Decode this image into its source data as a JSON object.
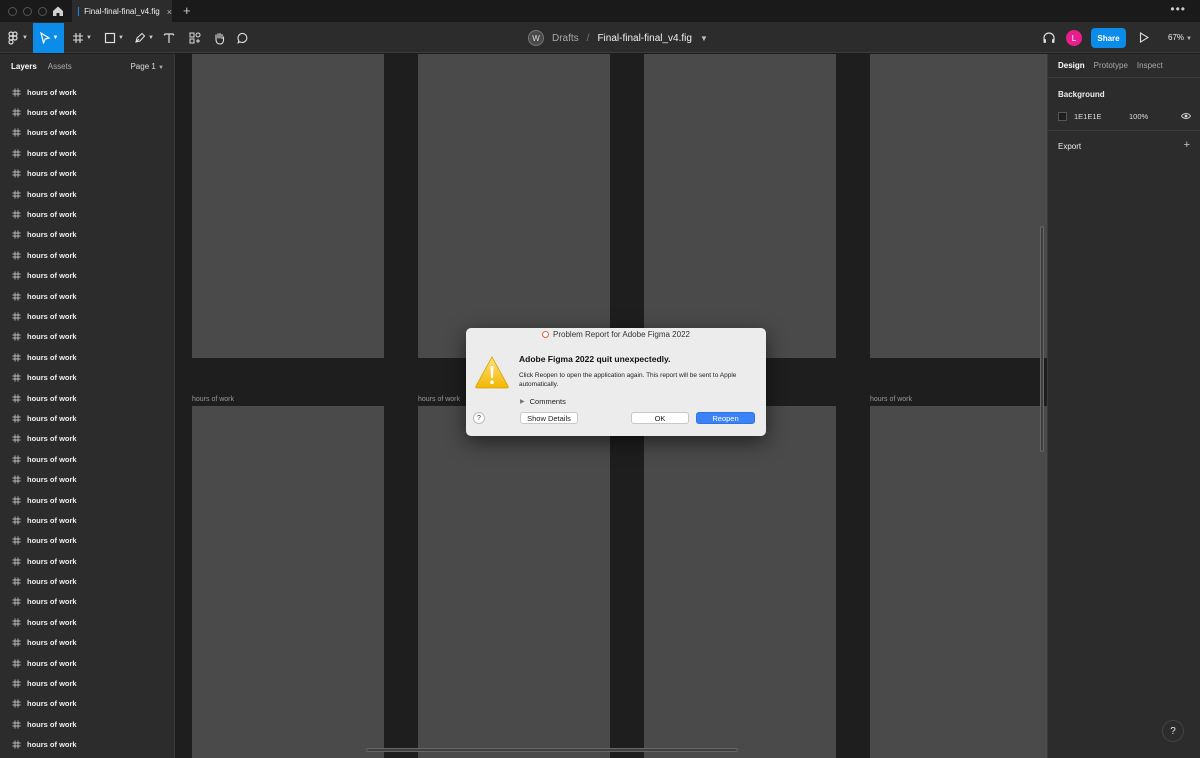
{
  "tabbar": {
    "tab_title": "Final-final-final_v4.fig",
    "tab_close": "×",
    "new_tab": "+",
    "more": "•••"
  },
  "toolbar": {
    "workspace_initial": "W",
    "breadcrumb_location": "Drafts",
    "breadcrumb_separator": "/",
    "file_name": "Final-final-final_v4.fig",
    "user_initial": "L",
    "share_label": "Share",
    "zoom": "67%"
  },
  "left_panel": {
    "tabs": [
      "Layers",
      "Assets"
    ],
    "page_selector": "Page 1",
    "layers": [
      "hours of work",
      "hours of work",
      "hours of work",
      "hours of work",
      "hours of work",
      "hours of work",
      "hours of work",
      "hours of work",
      "hours of work",
      "hours of work",
      "hours of work",
      "hours of work",
      "hours of work",
      "hours of work",
      "hours of work",
      "hours of work",
      "hours of work",
      "hours of work",
      "hours of work",
      "hours of work",
      "hours of work",
      "hours of work",
      "hours of work",
      "hours of work",
      "hours of work",
      "hours of work",
      "hours of work",
      "hours of work",
      "hours of work",
      "hours of work",
      "hours of work",
      "hours of work",
      "hours of work"
    ]
  },
  "canvas": {
    "frame_label": "hours of work"
  },
  "right_panel": {
    "tabs": [
      "Design",
      "Prototype",
      "Inspect"
    ],
    "background_title": "Background",
    "background_hex": "1E1E1E",
    "background_opacity": "100%",
    "export_title": "Export",
    "export_add": "+"
  },
  "help_button": "?",
  "dialog": {
    "title": "Problem Report for Adobe Figma 2022",
    "heading": "Adobe Figma 2022 quit unexpectedly.",
    "body": "Click Reopen to open the application again. This report will be sent to Apple automatically.",
    "comments_label": "Comments",
    "help": "?",
    "show_details": "Show Details",
    "ok": "OK",
    "reopen": "Reopen"
  },
  "colors": {
    "accent": "#0c8ce9",
    "avatar": "#e91e8c",
    "canvas_bg": "#1e1e1e",
    "frame": "#4a4a4a",
    "panel": "#2c2c2c"
  }
}
